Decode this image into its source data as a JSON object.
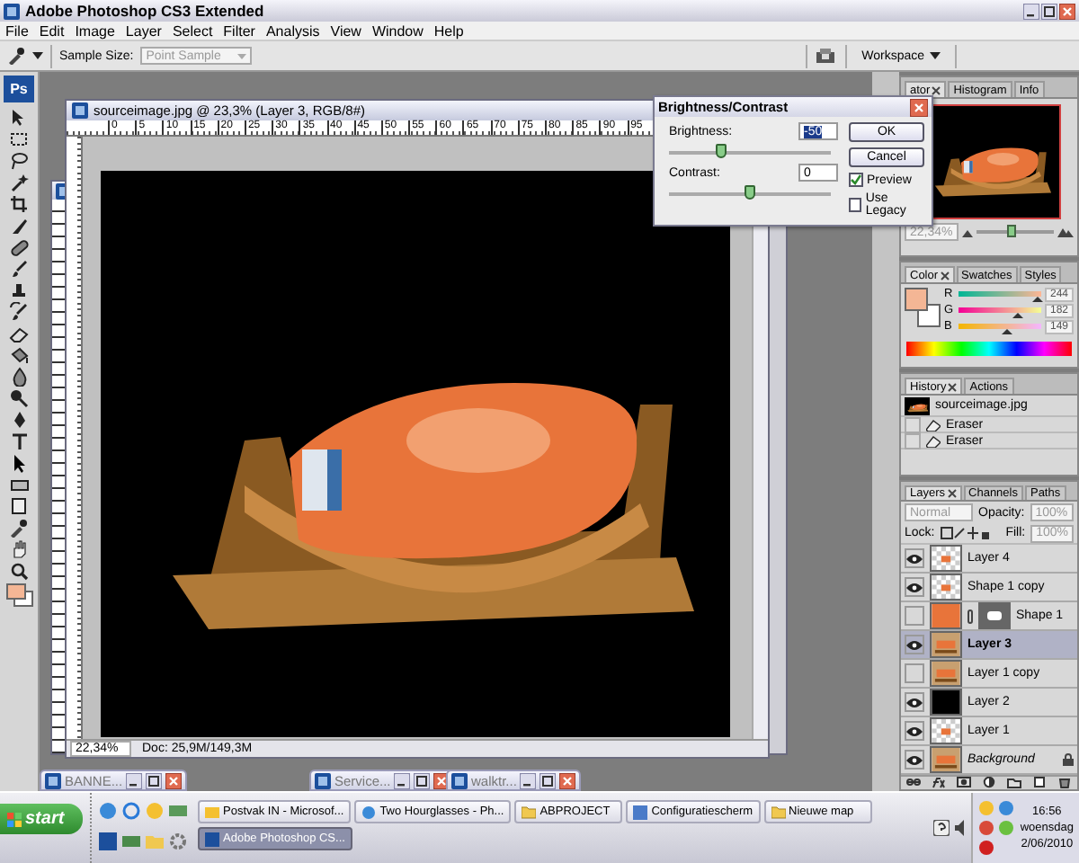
{
  "window": {
    "title": "Adobe Photoshop CS3 Extended"
  },
  "menu": [
    "File",
    "Edit",
    "Image",
    "Layer",
    "Select",
    "Filter",
    "Analysis",
    "View",
    "Window",
    "Help"
  ],
  "options_bar": {
    "sample_size_label": "Sample Size:",
    "sample_size": "Point Sample",
    "workspace": "Workspace"
  },
  "toolbox": {
    "logo": "Ps"
  },
  "document": {
    "title": "sourceimage.jpg @ 23,3% (Layer 3, RGB/8#)",
    "ruler_labels": [
      "0",
      "5",
      "10",
      "15",
      "20",
      "25",
      "30",
      "35",
      "40",
      "45",
      "50",
      "55",
      "60",
      "65",
      "70",
      "75",
      "80",
      "85",
      "90",
      "95"
    ],
    "zoom": "22,34%",
    "doc_size": "Doc: 25,9M/149,3M"
  },
  "dialog": {
    "title": "Brightness/Contrast",
    "fields": [
      {
        "label": "Brightness:",
        "value": "-50",
        "focused": true,
        "level": 0.32
      },
      {
        "label": "Contrast:",
        "value": "0",
        "focused": false,
        "level": 0.5
      }
    ],
    "buttons": [
      "OK",
      "Cancel"
    ],
    "options": [
      {
        "label": "Preview",
        "checked": true
      },
      {
        "label": "Use Legacy",
        "checked": false
      }
    ]
  },
  "navigator": {
    "tabs": [
      {
        "label": "ator",
        "selected": true
      },
      {
        "label": "Histogram",
        "selected": false
      },
      {
        "label": "Info",
        "selected": false
      }
    ],
    "zoom": "22,34%",
    "level": 0.45
  },
  "color": {
    "tabs": [
      {
        "label": "Color",
        "selected": true
      },
      {
        "label": "Swatches",
        "selected": false
      },
      {
        "label": "Styles",
        "selected": false
      }
    ],
    "swatches": [
      {
        "kind": "foreground",
        "color": "#f4b695"
      },
      {
        "kind": "background",
        "color": "#ffffff"
      }
    ],
    "channels": [
      {
        "name": "R",
        "value": "244",
        "level": 0.96
      },
      {
        "name": "G",
        "value": "182",
        "level": 0.71
      },
      {
        "name": "B",
        "value": "149",
        "level": 0.58
      }
    ]
  },
  "history": {
    "tabs": [
      {
        "label": "History",
        "selected": true
      },
      {
        "label": "Actions",
        "selected": false
      }
    ],
    "snapshot": "sourceimage.jpg",
    "states": [
      "Eraser",
      "Eraser"
    ]
  },
  "layers": {
    "tabs": [
      {
        "label": "Layers",
        "selected": true
      },
      {
        "label": "Channels",
        "selected": false
      },
      {
        "label": "Paths",
        "selected": false
      }
    ],
    "blend_mode": "Normal",
    "opacity_label": "Opacity:",
    "opacity": "100%",
    "lock_label": "Lock:",
    "fill_label": "Fill:",
    "fill": "100%",
    "items": [
      {
        "name": "Layer 4",
        "visible": true,
        "selected": false,
        "kind": "transparent"
      },
      {
        "name": "Shape 1 copy",
        "visible": true,
        "selected": false,
        "kind": "transparent"
      },
      {
        "name": "Shape 1",
        "visible": false,
        "selected": false,
        "kind": "shape"
      },
      {
        "name": "Layer 3",
        "visible": true,
        "selected": true,
        "kind": "image"
      },
      {
        "name": "Layer 1 copy",
        "visible": false,
        "selected": false,
        "kind": "image"
      },
      {
        "name": "Layer 2",
        "visible": true,
        "selected": false,
        "kind": "black"
      },
      {
        "name": "Layer 1",
        "visible": true,
        "selected": false,
        "kind": "transparent"
      },
      {
        "name": "Background",
        "visible": true,
        "selected": false,
        "kind": "background"
      }
    ]
  },
  "minimized_windows": [
    "BANNE...",
    "Service...",
    "walktr..."
  ],
  "taskbar": {
    "start": "start",
    "tasks": [
      {
        "label": "Postvak IN - Microsof...",
        "selected": false
      },
      {
        "label": "Two Hourglasses - Ph...",
        "selected": false
      },
      {
        "label": "ABPROJECT",
        "selected": false
      },
      {
        "label": "Configuratiescherm",
        "selected": false
      },
      {
        "label": "Nieuwe map",
        "selected": false
      },
      {
        "label": "Adobe Photoshop CS...",
        "selected": true
      }
    ],
    "clock": [
      "16:56",
      "woensdag",
      "2/06/2010"
    ]
  }
}
